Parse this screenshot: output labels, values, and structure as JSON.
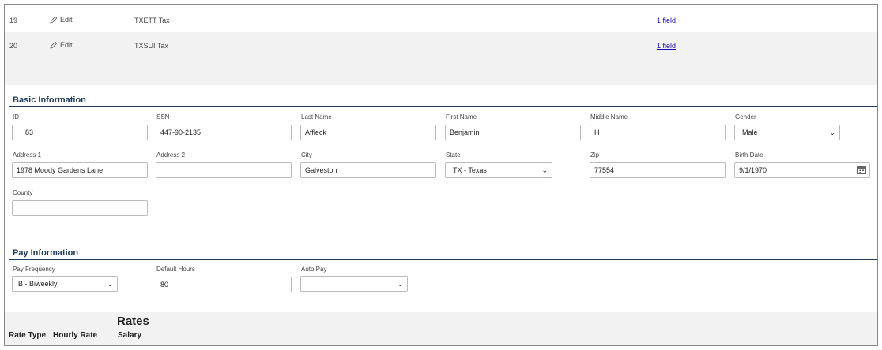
{
  "tax_rows": [
    {
      "num": "19",
      "edit_label": "Edit",
      "name": "TXETT Tax",
      "link": "1 field"
    },
    {
      "num": "20",
      "edit_label": "Edit",
      "name": "TXSUI Tax",
      "link": "1 field"
    }
  ],
  "basic": {
    "title": "Basic Information",
    "id_label": "ID",
    "id_value": "83",
    "ssn_label": "SSN",
    "ssn_value": "447-90-2135",
    "last_label": "Last Name",
    "last_value": "Affleck",
    "first_label": "First Name",
    "first_value": "Benjamin",
    "middle_label": "Middle Name",
    "middle_value": "H",
    "gender_label": "Gender",
    "gender_value": "Male",
    "addr1_label": "Address 1",
    "addr1_value": "1978 Moody Gardens Lane",
    "addr2_label": "Address 2",
    "addr2_value": "",
    "city_label": "City",
    "city_value": "Galveston",
    "state_label": "State",
    "state_value": "TX - Texas",
    "zip_label": "Zip",
    "zip_value": "77554",
    "birth_label": "Birth Date",
    "birth_value": "9/1/1970",
    "county_label": "County",
    "county_value": ""
  },
  "pay": {
    "title": "Pay Information",
    "freq_label": "Pay Frequency",
    "freq_value": "B - Biweekly",
    "hours_label": "Default Hours",
    "hours_value": "80",
    "auto_label": "Auto Pay",
    "auto_value": ""
  },
  "rates": {
    "title": "Rates",
    "col_rate_type": "Rate Type",
    "col_hourly": "Hourly Rate",
    "col_salary": "Salary"
  },
  "colors": {
    "link": "#1a0dab",
    "section": "#1f3a5a",
    "band": "#f2f2f2"
  }
}
